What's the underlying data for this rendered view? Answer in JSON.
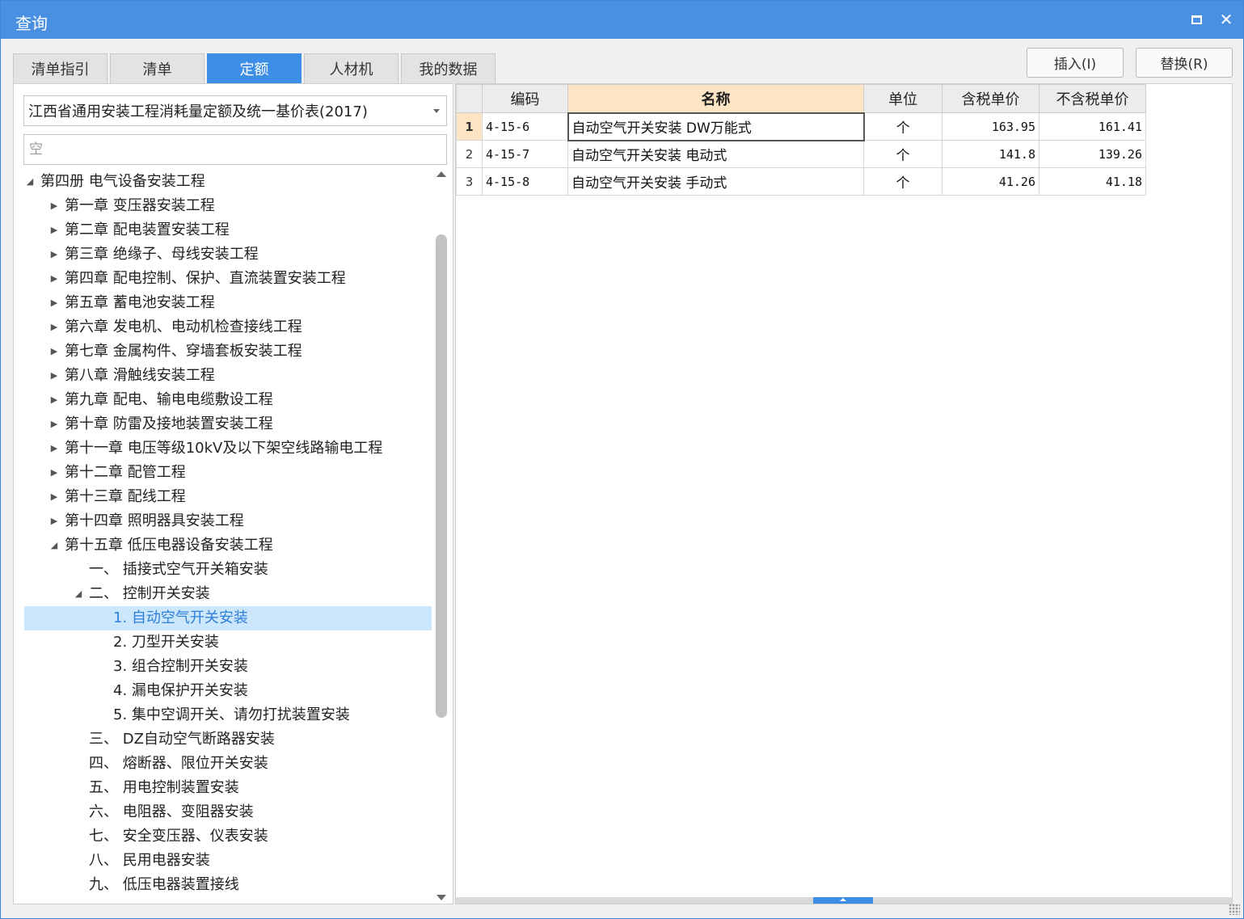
{
  "window": {
    "title": "查询"
  },
  "tabs": [
    {
      "label": "清单指引",
      "active": false
    },
    {
      "label": "清单",
      "active": false
    },
    {
      "label": "定额",
      "active": true
    },
    {
      "label": "人材机",
      "active": false
    },
    {
      "label": "我的数据",
      "active": false
    }
  ],
  "toolbar": {
    "insert_label": "插入(I)",
    "replace_label": "替换(R)"
  },
  "library": {
    "selected": "江西省通用安装工程消耗量定额及统一基价表(2017)"
  },
  "search": {
    "value": "",
    "placeholder": "空"
  },
  "tree": [
    {
      "label": "第四册 电气设备安装工程",
      "level": 0,
      "arrow": "expanded"
    },
    {
      "label": "第一章 变压器安装工程",
      "level": 1,
      "arrow": "collapsed"
    },
    {
      "label": "第二章 配电装置安装工程",
      "level": 1,
      "arrow": "collapsed"
    },
    {
      "label": "第三章 绝缘子、母线安装工程",
      "level": 1,
      "arrow": "collapsed"
    },
    {
      "label": "第四章 配电控制、保护、直流装置安装工程",
      "level": 1,
      "arrow": "collapsed"
    },
    {
      "label": "第五章 蓄电池安装工程",
      "level": 1,
      "arrow": "collapsed"
    },
    {
      "label": "第六章 发电机、电动机检查接线工程",
      "level": 1,
      "arrow": "collapsed"
    },
    {
      "label": "第七章 金属构件、穿墙套板安装工程",
      "level": 1,
      "arrow": "collapsed"
    },
    {
      "label": "第八章 滑触线安装工程",
      "level": 1,
      "arrow": "collapsed"
    },
    {
      "label": "第九章 配电、输电电缆敷设工程",
      "level": 1,
      "arrow": "collapsed"
    },
    {
      "label": "第十章 防雷及接地装置安装工程",
      "level": 1,
      "arrow": "collapsed"
    },
    {
      "label": "第十一章 电压等级10kV及以下架空线路输电工程",
      "level": 1,
      "arrow": "collapsed"
    },
    {
      "label": "第十二章 配管工程",
      "level": 1,
      "arrow": "collapsed"
    },
    {
      "label": "第十三章 配线工程",
      "level": 1,
      "arrow": "collapsed"
    },
    {
      "label": "第十四章 照明器具安装工程",
      "level": 1,
      "arrow": "collapsed"
    },
    {
      "label": "第十五章 低压电器设备安装工程",
      "level": 1,
      "arrow": "expanded"
    },
    {
      "label": "一、 插接式空气开关箱安装",
      "level": 2,
      "arrow": "none"
    },
    {
      "label": "二、 控制开关安装",
      "level": 2,
      "arrow": "expanded"
    },
    {
      "label": "1. 自动空气开关安装",
      "level": 3,
      "arrow": "none",
      "selected": true
    },
    {
      "label": "2. 刀型开关安装",
      "level": 3,
      "arrow": "none"
    },
    {
      "label": "3. 组合控制开关安装",
      "level": 3,
      "arrow": "none"
    },
    {
      "label": "4. 漏电保护开关安装",
      "level": 3,
      "arrow": "none"
    },
    {
      "label": "5. 集中空调开关、请勿打扰装置安装",
      "level": 3,
      "arrow": "none"
    },
    {
      "label": "三、 DZ自动空气断路器安装",
      "level": 2,
      "arrow": "none"
    },
    {
      "label": "四、 熔断器、限位开关安装",
      "level": 2,
      "arrow": "none"
    },
    {
      "label": "五、 用电控制装置安装",
      "level": 2,
      "arrow": "none"
    },
    {
      "label": "六、 电阻器、变阻器安装",
      "level": 2,
      "arrow": "none"
    },
    {
      "label": "七、 安全变压器、仪表安装",
      "level": 2,
      "arrow": "none"
    },
    {
      "label": "八、 民用电器安装",
      "level": 2,
      "arrow": "none"
    },
    {
      "label": "九、 低压电器装置接线",
      "level": 2,
      "arrow": "none"
    }
  ],
  "grid": {
    "headers": {
      "code": "编码",
      "name": "名称",
      "unit": "单位",
      "price_tax": "含税单价",
      "price_notax": "不含税单价"
    },
    "rows": [
      {
        "no": "1",
        "code": "4-15-6",
        "name": "自动空气开关安装 DW万能式",
        "unit": "个",
        "price_tax": "163.95",
        "price_notax": "161.41"
      },
      {
        "no": "2",
        "code": "4-15-7",
        "name": "自动空气开关安装 电动式",
        "unit": "个",
        "price_tax": "141.8",
        "price_notax": "139.26"
      },
      {
        "no": "3",
        "code": "4-15-8",
        "name": "自动空气开关安装 手动式",
        "unit": "个",
        "price_tax": "41.26",
        "price_notax": "41.18"
      }
    ]
  },
  "colors": {
    "accent": "#4a90e2",
    "tab_active": "#3d8ee6",
    "selected_row": "#cce6fb",
    "header_highlight": "#fde4c3"
  }
}
